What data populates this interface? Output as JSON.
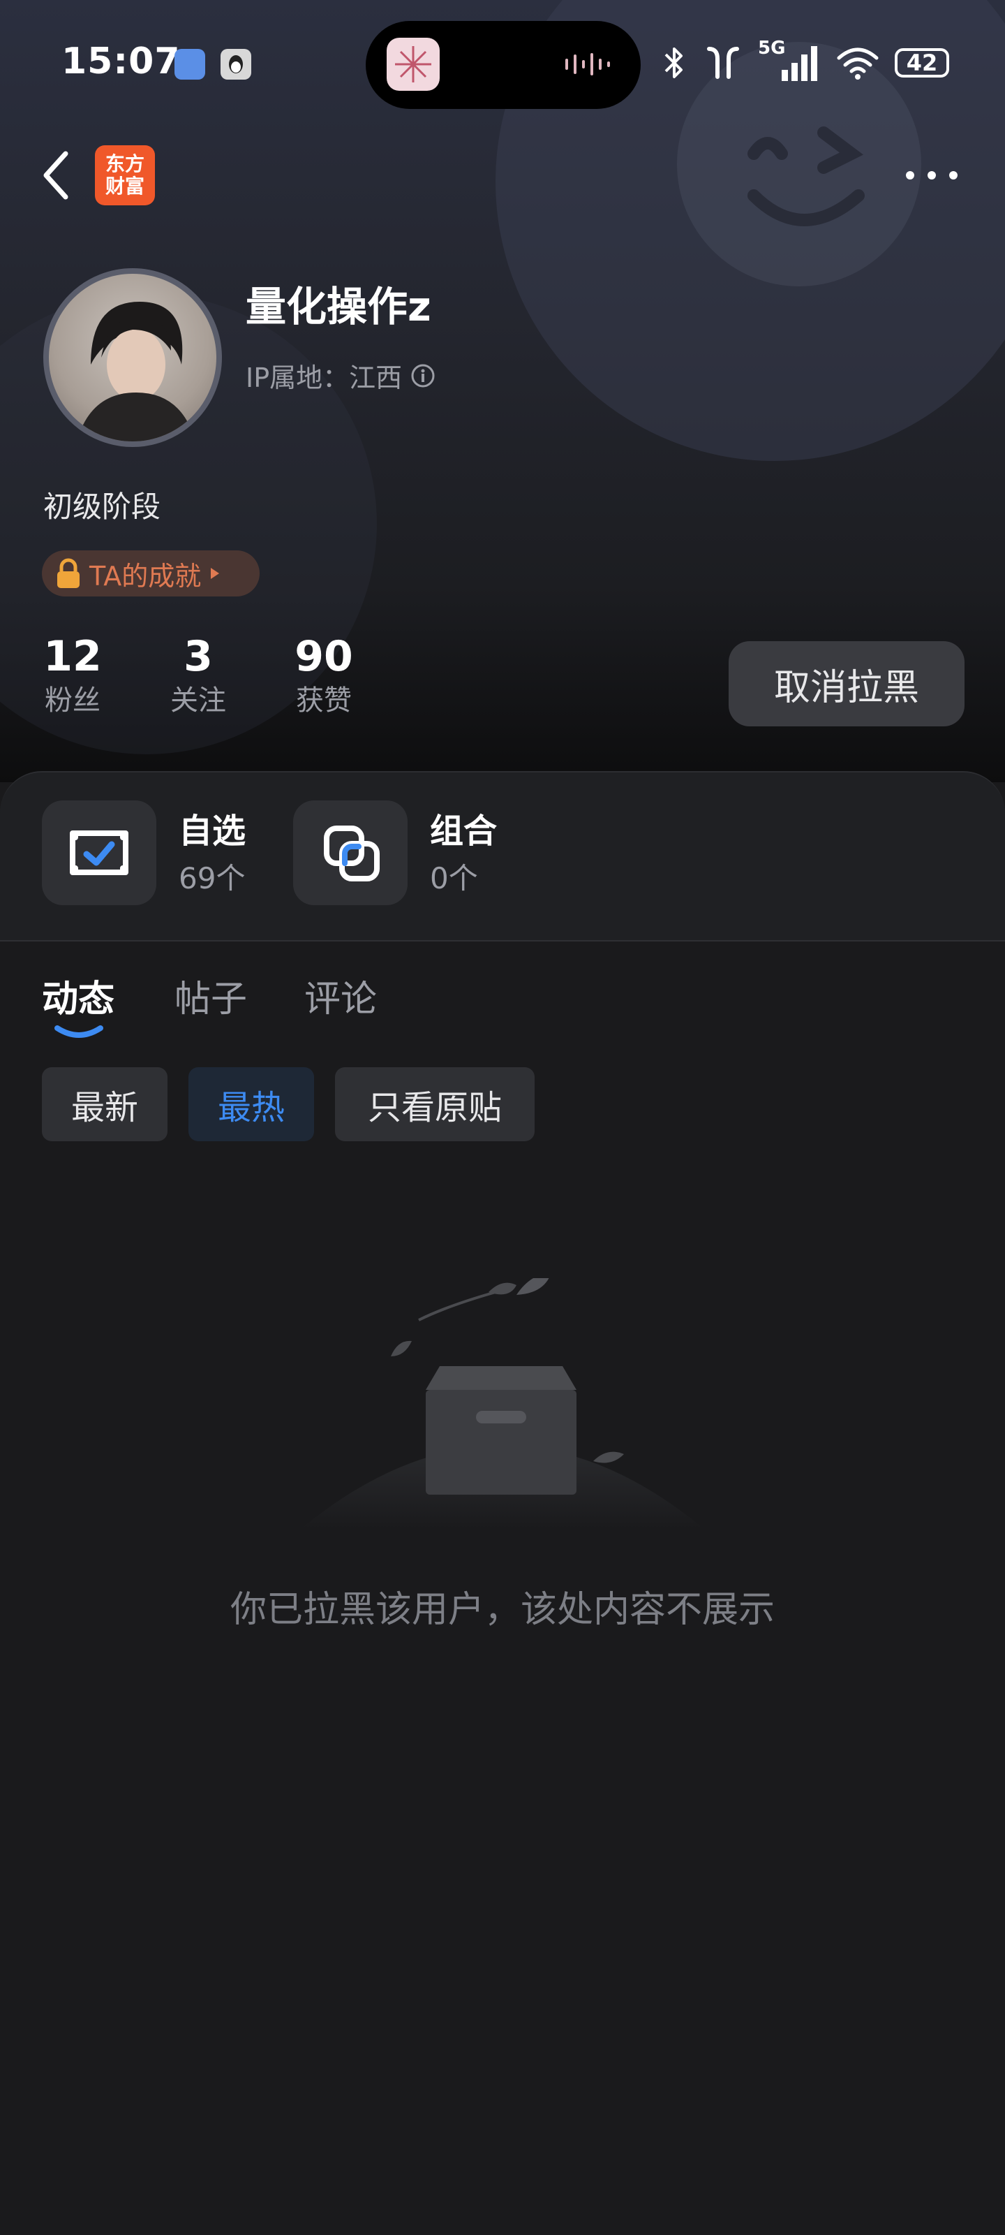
{
  "status_bar": {
    "time": "15:07",
    "network": "5G",
    "battery": "42",
    "icons": [
      "bluetooth-icon",
      "earbuds-icon",
      "signal-icon",
      "wifi-icon",
      "battery-icon"
    ]
  },
  "nav": {
    "back_icon": "chevron-left-icon",
    "brand_badge": "东方财富",
    "more_icon": "more-dots-icon"
  },
  "profile": {
    "username": "量化操作z",
    "ip_location": "IP属地：江西",
    "level": "初级阶段",
    "achievement_label": "TA的成就",
    "stats": [
      {
        "value": "12",
        "label": "粉丝"
      },
      {
        "value": "3",
        "label": "关注"
      },
      {
        "value": "90",
        "label": "获赞"
      }
    ],
    "unblock_button": "取消拉黑"
  },
  "features": [
    {
      "title": "自选",
      "count": "69个",
      "icon": "watchlist-check-icon"
    },
    {
      "title": "组合",
      "count": "0个",
      "icon": "portfolio-squares-icon"
    }
  ],
  "tabs": [
    {
      "label": "动态",
      "active": true
    },
    {
      "label": "帖子",
      "active": false
    },
    {
      "label": "评论",
      "active": false
    }
  ],
  "filters": [
    {
      "label": "最新",
      "active": false
    },
    {
      "label": "最热",
      "active": true
    },
    {
      "label": "只看原贴",
      "active": false
    }
  ],
  "empty_state": {
    "message": "你已拉黑该用户，该处内容不展示",
    "icon": "empty-box-icon"
  },
  "colors": {
    "accent_blue": "#3d8bf2",
    "brand_orange": "#f0582a",
    "achievement_orange": "#e07a52",
    "background": "#1a1a1c"
  }
}
